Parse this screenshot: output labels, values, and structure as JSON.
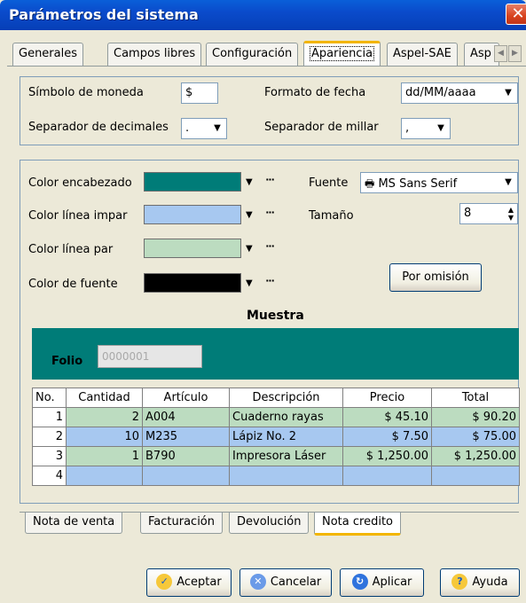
{
  "window": {
    "title": "Parámetros del sistema"
  },
  "tabs": [
    {
      "label": "Generales"
    },
    {
      "label": "Campos libres"
    },
    {
      "label": "Configuración"
    },
    {
      "label": "Apariencia"
    },
    {
      "label": "Aspel-SAE"
    },
    {
      "label": "Asp"
    }
  ],
  "format": {
    "currency_symbol_label": "Símbolo de moneda",
    "currency_symbol_value": "$",
    "date_format_label": "Formato de fecha",
    "date_format_value": "dd/MM/aaaa",
    "decimal_sep_label": "Separador de decimales",
    "decimal_sep_value": ".",
    "thousands_sep_label": "Separador de millar",
    "thousands_sep_value": ","
  },
  "appearance": {
    "header_color_label": "Color encabezado",
    "header_color": "#007C78",
    "odd_line_label": "Color línea impar",
    "odd_line_color": "#A7C8F0",
    "even_line_label": "Color línea par",
    "even_line_color": "#BCDCC0",
    "font_color_label": "Color de fuente",
    "font_color": "#000000",
    "font_label": "Fuente",
    "font_value": "MS Sans Serif",
    "size_label": "Tamaño",
    "size_value": "8",
    "default_button": "Por omisión",
    "more_glyph": "···"
  },
  "sample": {
    "title": "Muestra",
    "folio_label": "Folio",
    "folio_value": "0000001",
    "columns": [
      "No.",
      "Cantidad",
      "Artículo",
      "Descripción",
      "Precio",
      "Total"
    ],
    "rows": [
      {
        "no": "1",
        "cantidad": "2",
        "articulo": "A004",
        "descripcion": "Cuaderno rayas",
        "precio": "$ 45.10",
        "total": "$ 90.20"
      },
      {
        "no": "2",
        "cantidad": "10",
        "articulo": "M235",
        "descripcion": "Lápiz No. 2",
        "precio": "$ 7.50",
        "total": "$ 75.00"
      },
      {
        "no": "3",
        "cantidad": "1",
        "articulo": "B790",
        "descripcion": "Impresora Láser",
        "precio": "$ 1,250.00",
        "total": "$ 1,250.00"
      },
      {
        "no": "4",
        "cantidad": "",
        "articulo": "",
        "descripcion": "",
        "precio": "",
        "total": ""
      }
    ]
  },
  "bottom_tabs": [
    {
      "label": "Nota de venta"
    },
    {
      "label": "Facturación"
    },
    {
      "label": "Devolución"
    },
    {
      "label": "Nota credito"
    }
  ],
  "buttons": {
    "accept": "Aceptar",
    "cancel": "Cancelar",
    "apply": "Aplicar",
    "help": "Ayuda"
  }
}
